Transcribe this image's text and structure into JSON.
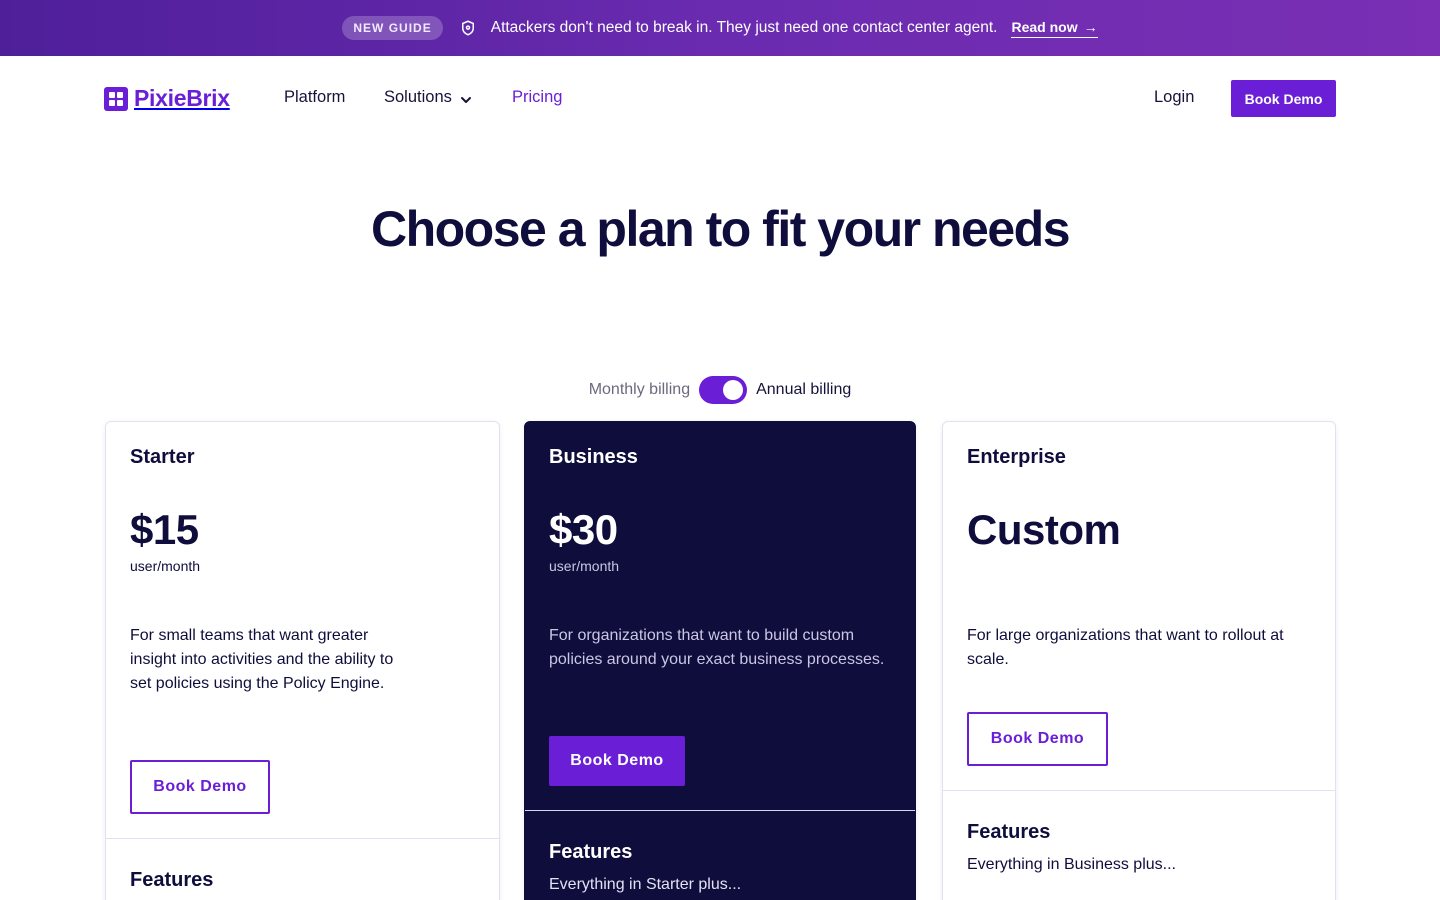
{
  "banner": {
    "badge": "NEW GUIDE",
    "text": "Attackers don't need to break in. They just need one contact center agent.",
    "link": "Read now",
    "icon": "shield-icon"
  },
  "nav": {
    "logo": "PixieBrix",
    "links": [
      "Platform",
      "Solutions",
      "Pricing"
    ],
    "active": "Pricing",
    "login": "Login",
    "cta": "Book Demo"
  },
  "hero": {
    "title": "Choose a plan to fit your needs"
  },
  "billing": {
    "monthly": "Monthly billing",
    "annual": "Annual billing",
    "annual_selected": true
  },
  "plans": [
    {
      "name": "Starter",
      "price": "$15",
      "unit": "user/month",
      "description": "For small teams that want greater insight into activities and the ability to set policies using the Policy Engine.",
      "cta": "Book Demo",
      "features_title": "Features",
      "features_intro": ""
    },
    {
      "name": "Business",
      "price": "$30",
      "unit": "user/month",
      "description": "For organizations that want to build custom policies around your exact business processes.",
      "cta": "Book Demo",
      "features_title": "Features",
      "features_intro": "Everything in Starter plus..."
    },
    {
      "name": "Enterprise",
      "price": "Custom",
      "unit": "",
      "description": "For large organizations that want to rollout at scale.",
      "cta": "Book Demo",
      "features_title": "Features",
      "features_intro": "Everything in Business plus..."
    }
  ],
  "colors": {
    "brand": "#6a1fd6",
    "dark_card": "#0f0d3b",
    "banner_start": "#4f1f9a",
    "banner_end": "#7a2fb4"
  }
}
